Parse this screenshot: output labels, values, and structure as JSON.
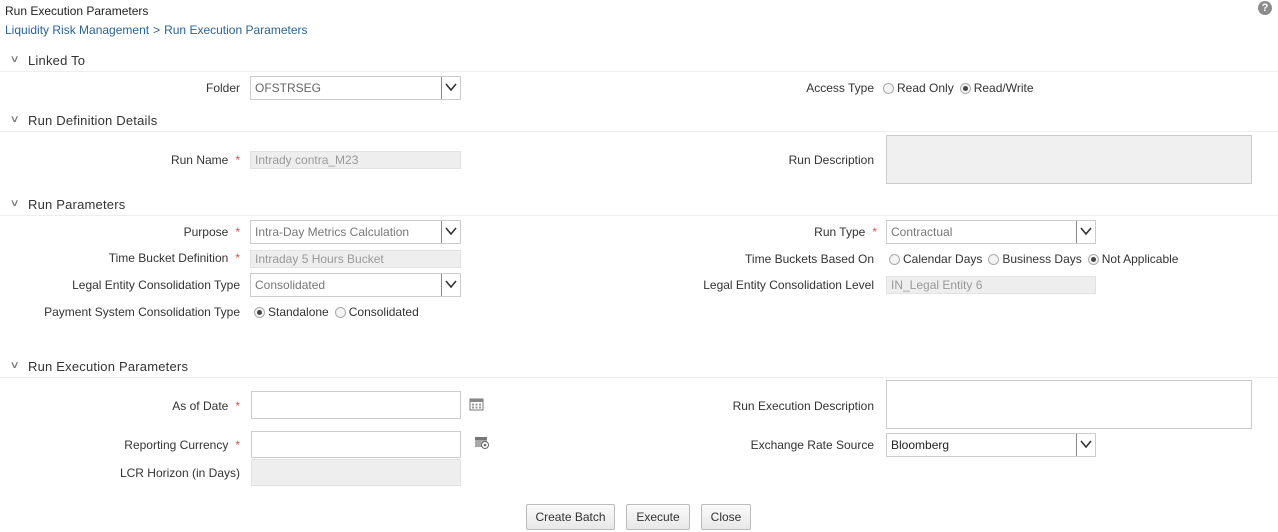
{
  "page": {
    "title": "Run Execution Parameters",
    "help_icon": "question-circle-icon",
    "breadcrumb": {
      "parent": "Liquidity Risk Management",
      "separator": ">",
      "current": "Run Execution Parameters"
    }
  },
  "linked_to": {
    "section_title": "Linked To",
    "folder_label": "Folder",
    "folder_value": "OFSTRSEG",
    "access_type_label": "Access Type",
    "access_options": [
      {
        "label": "Read Only",
        "selected": false
      },
      {
        "label": "Read/Write",
        "selected": true
      }
    ]
  },
  "run_definition": {
    "section_title": "Run Definition Details",
    "run_name_label": "Run Name",
    "run_name_value": "Intrady contra_M23",
    "run_description_label": "Run Description",
    "required_mark": "*"
  },
  "run_parameters": {
    "section_title": "Run Parameters",
    "purpose_label": "Purpose",
    "purpose_value": "Intra-Day Metrics Calculation",
    "run_type_label": "Run Type",
    "run_type_value": "Contractual",
    "time_bucket_label": "Time Bucket Definition",
    "time_bucket_value": "Intraday 5 Hours Bucket",
    "time_buckets_based_on_label": "Time Buckets Based On",
    "time_buckets_options": [
      {
        "label": "Calendar Days",
        "selected": false
      },
      {
        "label": "Business Days",
        "selected": false
      },
      {
        "label": "Not Applicable",
        "selected": true
      }
    ],
    "legal_entity_type_label": "Legal Entity Consolidation Type",
    "legal_entity_type_value": "Consolidated",
    "legal_entity_level_label": "Legal Entity Consolidation Level",
    "legal_entity_level_value": "IN_Legal Entity 6",
    "payment_system_label": "Payment System Consolidation Type",
    "payment_options": [
      {
        "label": "Standalone",
        "selected": true
      },
      {
        "label": "Consolidated",
        "selected": false
      }
    ]
  },
  "run_execution": {
    "section_title": "Run Execution Parameters",
    "as_of_date_label": "As of Date",
    "as_of_date_value": "",
    "calendar_icon": "calendar-icon",
    "run_exec_desc_label": "Run Execution Description",
    "reporting_currency_label": "Reporting Currency",
    "reporting_currency_value": "",
    "lookup_icon": "lookup-icon",
    "exchange_rate_label": "Exchange Rate Source",
    "exchange_rate_value": "Bloomberg",
    "lcr_horizon_label": "LCR Horizon (in Days)",
    "lcr_horizon_value": ""
  },
  "actions": {
    "create_batch": "Create Batch",
    "execute": "Execute",
    "close": "Close"
  },
  "colors": {
    "link": "#2a6496",
    "required": "#d9534f",
    "readonly_bg": "#eeeeee"
  }
}
